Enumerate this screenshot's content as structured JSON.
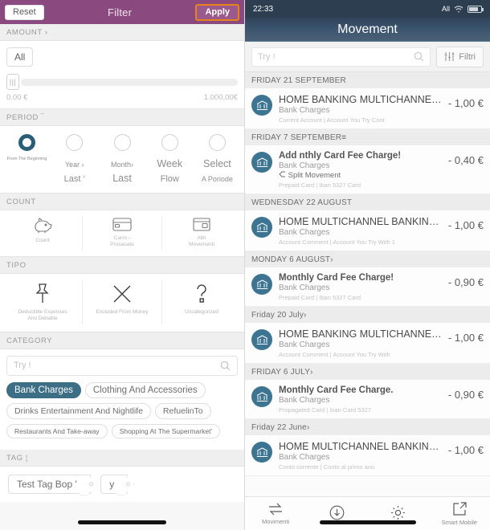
{
  "filter_panel": {
    "header": {
      "reset": "Reset",
      "title": "Filter",
      "apply": "Apply"
    },
    "amount": {
      "section_label": "AMOUNT ›",
      "all_chip": "All",
      "min": "0.00 €",
      "max": "1.000,00",
      "max_currency": "€"
    },
    "period": {
      "section_label": "PERIOD ‾",
      "options": [
        {
          "label": "From The Beginning",
          "selected": true
        },
        {
          "label_top": "Year ›",
          "label_bottom": "Last ‘",
          "selected": false
        },
        {
          "label_top": "Month›",
          "label_bottom": "Last",
          "selected": false
        },
        {
          "label_top": "Week",
          "label_bottom": "Flow",
          "selected": false
        },
        {
          "label_top": "Select",
          "label_bottom": "A Poriode",
          "selected": false
        }
      ]
    },
    "count": {
      "section_label": "COUNT",
      "items": [
        {
          "icon": "piggy-bank-icon",
          "caption": "Count"
        },
        {
          "icon": "credit-card-icon",
          "caption": "Carro ›\nProsaoate"
        },
        {
          "icon": "other-card-icon",
          "caption": "Altri\nMovementi"
        }
      ]
    },
    "tipo": {
      "section_label": "TIPO",
      "items": [
        {
          "icon": "pin-icon",
          "caption": "Deductible Expenses\nAnd Deltable"
        },
        {
          "icon": "x-cross-icon",
          "caption": "Excluded From Money"
        },
        {
          "icon": "question-mark-icon",
          "caption": "Uncategorized"
        }
      ]
    },
    "category": {
      "section_label": "CATEGORY",
      "search_placeholder": "Try !",
      "chips": [
        {
          "label": "Bank Charges",
          "selected": true,
          "size": "c-12"
        },
        {
          "label": "Clothing And Accessories",
          "selected": false,
          "size": "c-12"
        },
        {
          "label": "Drinks Entertainment And Nightlife",
          "selected": false,
          "size": "c-11"
        },
        {
          "label": "RefuelinTo",
          "selected": false,
          "size": "c-11"
        },
        {
          "label": "Restaurants And Take-away",
          "selected": false,
          "size": "c-9"
        },
        {
          "label": "Shopping At The Supermarket'",
          "selected": false,
          "size": "c-9"
        }
      ]
    },
    "tag": {
      "section_label": "TAG ¦",
      "chips": [
        {
          "label": "Test Tag Bop '"
        },
        {
          "label": "y"
        }
      ]
    }
  },
  "movement_panel": {
    "statusbar": {
      "time": "22:33",
      "carrier": "All"
    },
    "nav": {
      "title": "Movement"
    },
    "search": {
      "placeholder": "Try !",
      "filter_button": "Filtri"
    },
    "groups": [
      {
        "day": "FRIDAY 21 SEPTEMBER",
        "rows": [
          {
            "title": "HOME BANKING MULTICHANNEL-...",
            "category": "Bank Charges",
            "account": "Current Account | Account You Try Cont",
            "amount": "- 1,00",
            "currency": "€",
            "glitch": true,
            "split": null
          }
        ]
      },
      {
        "day": "FRIDAY 7 SEPTEMBER≡",
        "rows": [
          {
            "title": "Add nthly Card Fee Charge!",
            "category": "Bank Charges",
            "account": "Prepaid Card | Iban 5327 Card",
            "amount": "- 0,40 €",
            "currency": "",
            "glitch": false,
            "split": "Split Movement",
            "bold": true
          }
        ]
      },
      {
        "day": "WEDNESDAY 22 AUGUST",
        "rows": [
          {
            "title": "HOME MULTICHANNEL BANKING-...",
            "category": "Bank Charges",
            "account": "Account Comment | Account You Try With 1",
            "amount": "- 1,00",
            "currency": "€",
            "glitch": false,
            "split": null
          }
        ]
      },
      {
        "day": "MONDAY 6 AUGUST›",
        "rows": [
          {
            "title": "Monthly Card Fee Charge!",
            "category": "Bank Charges",
            "account": "Prepaid Card | Iban 5327 Card",
            "amount": "- 0,90",
            "currency": "€",
            "glitch": false,
            "split": null,
            "bold": true
          }
        ]
      },
      {
        "day": "Friday 20 July›",
        "rows": [
          {
            "title": "HOME BANKING MULTICHANNEL-...",
            "category": "Bank Charges",
            "account": "Account Comment | Account You Try With",
            "amount": "- 1,00 €",
            "currency": "",
            "glitch": true,
            "split": null
          }
        ]
      },
      {
        "day": "FRIDAY 6 JULY›",
        "rows": [
          {
            "title": "Monthly Card Fee Charge.",
            "category": "Bank Charges",
            "account": "Propagated Card | Ioan Card 5327",
            "amount": "- 0,90",
            "currency": "€",
            "glitch": false,
            "split": null,
            "bold": true
          }
        ]
      },
      {
        "day": "Friday 22 June›",
        "rows": [
          {
            "title": "HOME MULTICHANNEL BANKING-...",
            "category": "Bank Charges",
            "account": "Conto corrente | Conto al primo ano",
            "amount": "- 1,00",
            "currency": "€",
            "glitch": false,
            "split": null
          }
        ]
      }
    ],
    "tabs": [
      {
        "icon": "transfer-arrows-icon",
        "label": "Movimenti"
      },
      {
        "icon": "download-circle-icon",
        "label": ""
      },
      {
        "icon": "gear-icon",
        "label": ""
      },
      {
        "icon": "external-link-icon",
        "label": "Smart Mobile"
      }
    ]
  }
}
